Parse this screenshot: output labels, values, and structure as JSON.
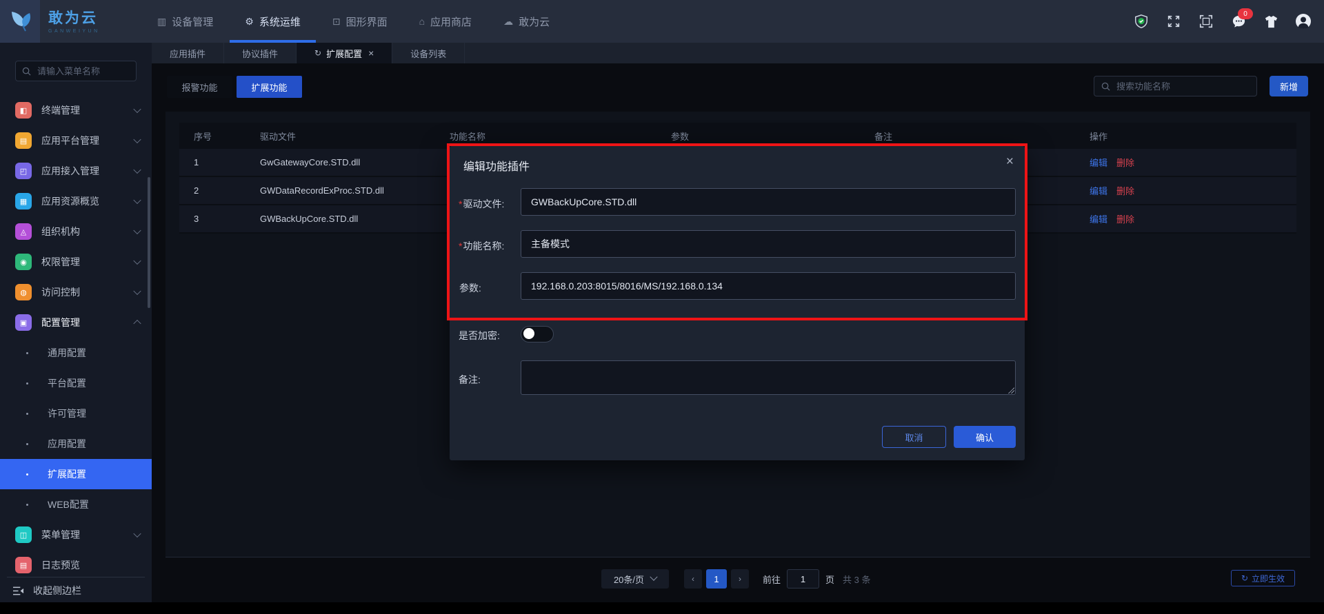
{
  "navbar": {
    "brand": {
      "title": "敢为云",
      "subtitle": "GANWEIYUN"
    },
    "items": [
      {
        "label": "设备管理",
        "icon": "device-grid-icon",
        "glyph": "▥",
        "active": false
      },
      {
        "label": "系统运维",
        "icon": "wrench-icon",
        "glyph": "⚙",
        "active": true
      },
      {
        "label": "图形界面",
        "icon": "monitor-icon",
        "glyph": "⊡",
        "active": false
      },
      {
        "label": "应用商店",
        "icon": "store-icon",
        "glyph": "⌂",
        "active": false
      },
      {
        "label": "敢为云",
        "icon": "cloud-icon",
        "glyph": "☁",
        "active": false
      }
    ],
    "message_badge": "0"
  },
  "tabs": [
    {
      "label": "应用插件",
      "active": false,
      "refresh": false,
      "closable": false
    },
    {
      "label": "协议插件",
      "active": false,
      "refresh": false,
      "closable": false
    },
    {
      "label": "扩展配置",
      "active": true,
      "refresh": true,
      "closable": true
    },
    {
      "label": "设备列表",
      "active": false,
      "refresh": false,
      "closable": false
    }
  ],
  "sidebar": {
    "search_placeholder": "请输入菜单名称",
    "items": [
      {
        "label": "终端管理",
        "color": "#e16a63",
        "glyph": "◧",
        "icon": "terminal-management-icon",
        "chevron": "down"
      },
      {
        "label": "应用平台管理",
        "color": "#f0a732",
        "glyph": "▤",
        "icon": "app-platform-icon",
        "chevron": "down"
      },
      {
        "label": "应用接入管理",
        "color": "#7868e6",
        "glyph": "◰",
        "icon": "app-access-icon",
        "chevron": "down"
      },
      {
        "label": "应用资源概览",
        "color": "#29a6e8",
        "glyph": "▦",
        "icon": "app-resource-icon",
        "chevron": "down"
      },
      {
        "label": "组织机构",
        "color": "#b44fd8",
        "glyph": "◬",
        "icon": "organization-icon",
        "chevron": "down"
      },
      {
        "label": "权限管理",
        "color": "#2eb87a",
        "glyph": "◉",
        "icon": "permission-icon",
        "chevron": "down"
      },
      {
        "label": "访问控制",
        "color": "#ef8f2e",
        "glyph": "◍",
        "icon": "access-control-icon",
        "chevron": "down"
      },
      {
        "label": "配置管理",
        "color": "#8a6ce8",
        "glyph": "▣",
        "icon": "config-management-icon",
        "chevron": "up",
        "expanded": true,
        "children": [
          {
            "label": "通用配置",
            "selected": false
          },
          {
            "label": "平台配置",
            "selected": false
          },
          {
            "label": "许可管理",
            "selected": false
          },
          {
            "label": "应用配置",
            "selected": false
          },
          {
            "label": "扩展配置",
            "selected": true
          },
          {
            "label": "WEB配置",
            "selected": false
          }
        ]
      },
      {
        "label": "菜单管理",
        "color": "#1fc9c4",
        "glyph": "◫",
        "icon": "menu-management-icon",
        "chevron": "down"
      },
      {
        "label": "日志预览",
        "color": "#e4636c",
        "glyph": "▤",
        "icon": "log-preview-icon",
        "chevron": "none"
      }
    ],
    "collapse_label": "收起侧边栏"
  },
  "content": {
    "filter_buttons": [
      {
        "label": "报警功能",
        "active": false
      },
      {
        "label": "扩展功能",
        "active": true
      }
    ],
    "search_placeholder": "搜索功能名称",
    "add_button": "新增",
    "table": {
      "headers": [
        "序号",
        "驱动文件",
        "功能名称",
        "参数",
        "备注",
        "操作"
      ],
      "rows": [
        {
          "index": "1",
          "driver": "GwGatewayCore.STD.dll",
          "name": "",
          "params": "",
          "remark": ""
        },
        {
          "index": "2",
          "driver": "GWDataRecordExProc.STD.dll",
          "name": "",
          "params": "",
          "remark": ""
        },
        {
          "index": "3",
          "driver": "GWBackUpCore.STD.dll",
          "name": "",
          "params": "",
          "remark": ""
        }
      ],
      "actions": {
        "edit": "编辑",
        "delete": "删除"
      }
    },
    "pagination": {
      "page_size": "20条/页",
      "prev": "‹",
      "current_page": "1",
      "next": "›",
      "goto_label": "前往",
      "goto_value": "1",
      "page_label": "页",
      "total_label": "共 3 条"
    },
    "apply_button": "立即生效"
  },
  "modal": {
    "title": "编辑功能插件",
    "close_icon": "×",
    "fields": [
      {
        "label": "驱动文件:",
        "required": true,
        "value": "GWBackUpCore.STD.dll"
      },
      {
        "label": "功能名称:",
        "required": true,
        "value": "主备模式"
      },
      {
        "label": "参数:",
        "required": false,
        "value": "192.168.0.203:8015/8016/MS/192.168.0.134"
      }
    ],
    "encrypt_label": "是否加密:",
    "encrypt_on": false,
    "note_label": "备注:",
    "note_value": "",
    "cancel_label": "取消",
    "confirm_label": "确认"
  },
  "colors": {
    "accent_blue": "#2a5bd7",
    "sidebar_selected": "#3466f2",
    "annotation_red": "#ee1416",
    "edit_link": "#3d74e8",
    "delete_link": "#d5414e",
    "badge_red": "#e8343f",
    "shield_green": "#22b24c"
  }
}
